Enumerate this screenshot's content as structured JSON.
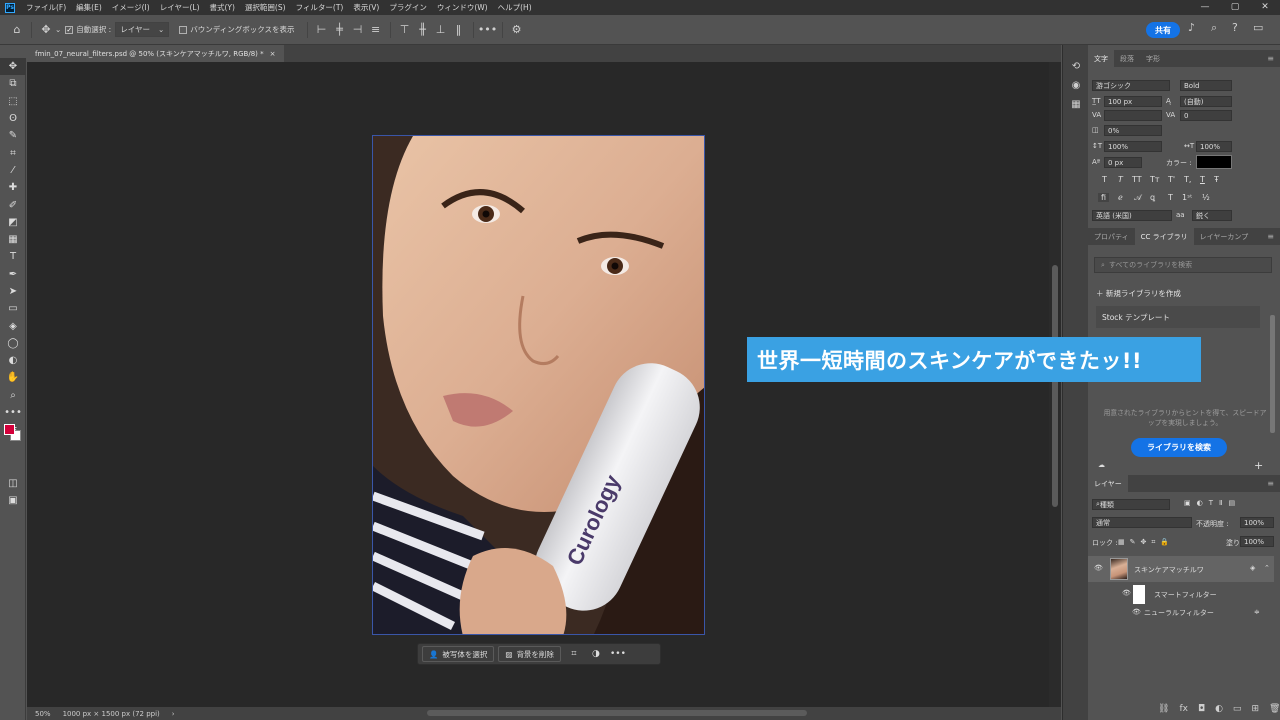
{
  "menu": {
    "items": [
      "ファイル(F)",
      "編集(E)",
      "イメージ(I)",
      "レイヤー(L)",
      "書式(Y)",
      "選択範囲(S)",
      "フィルター(T)",
      "表示(V)",
      "プラグイン",
      "ウィンドウ(W)",
      "ヘルプ(H)"
    ],
    "window_controls": [
      "—",
      "▢",
      "✕"
    ]
  },
  "options_bar": {
    "auto_select_label": "自動選択 :",
    "auto_select_value": "レイヤー",
    "bounding_box_label": "バウンディングボックスを表示",
    "share_label": "共有"
  },
  "document": {
    "tab_title": "fmin_07_neural_filters.psd @ 50% (スキンケアマッチルワ, RGB/8) *",
    "zoom": "50%",
    "size_info": "1000 px × 1500 px (72 ppi)",
    "product_text": "Curology"
  },
  "context_bar": {
    "select_subject": "被写体を選択",
    "remove_bg": "背景を削除"
  },
  "banner": {
    "text": "世界一短時間のスキンケアができたッ!!"
  },
  "character_panel": {
    "tabs": [
      "文字",
      "段落",
      "字形"
    ],
    "font_family": "游ゴシック",
    "font_style": "Bold",
    "font_size": "100 px",
    "leading": "(自動)",
    "tracking_value": "0",
    "kerning_pct": "0%",
    "vscale": "100%",
    "hscale": "100%",
    "baseline": "0 px",
    "color_label": "カラー :",
    "style_buttons": [
      "T",
      "T",
      "TT",
      "Tт",
      "T'",
      "T,",
      "T",
      "Ŧ"
    ],
    "language": "英語 (米国)",
    "antialias": "鋭く",
    "aa_label": "aa"
  },
  "library_panel": {
    "tabs": [
      "プロパティ",
      "CC ライブラリ",
      "レイヤーカンプ"
    ],
    "search_placeholder": "すべてのライブラリを検索",
    "new_library": "新規ライブラリを作成",
    "stock_templates": "Stock テンプレート",
    "hint": "用意されたライブラリからヒントを得て、スピードアップを実現しましょう。",
    "find_button": "ライブラリを検索"
  },
  "layers_panel": {
    "tab": "レイヤー",
    "kind_filter": "種類",
    "blend_mode": "通常",
    "opacity_label": "不透明度 :",
    "opacity_value": "100%",
    "lock_label": "ロック :",
    "fill_label": "塗り :",
    "fill_value": "100%",
    "layer_name": "スキンケアマッチルワ",
    "smart_filters": "スマートフィルター",
    "neural_filter": "ニューラルフィルター"
  }
}
